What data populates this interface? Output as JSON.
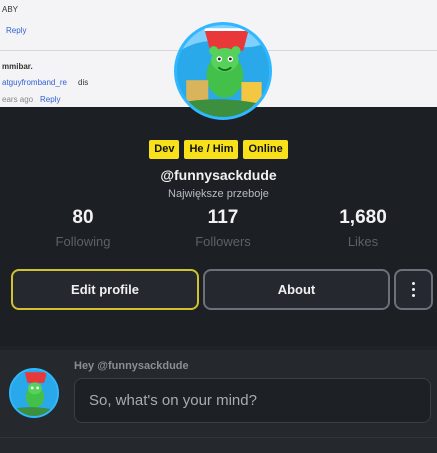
{
  "background_page": {
    "line1_text": "ABY",
    "line1_reply": "Reply",
    "line2_name": "mmibar.",
    "line2_link": "atguyfromband_re",
    "line2_suffix": "dis",
    "line2_time": "ears ago",
    "line2_reply": "Reply"
  },
  "profile": {
    "badges": [
      "Dev",
      "He / Him",
      "Online"
    ],
    "username": "@funnysackdude",
    "subtitle": "Największe przeboje",
    "stats": {
      "following": {
        "value": "80",
        "label": "Following"
      },
      "followers": {
        "value": "117",
        "label": "Followers"
      },
      "likes": {
        "value": "1,680",
        "label": "Likes"
      }
    },
    "buttons": {
      "edit": "Edit profile",
      "about": "About"
    }
  },
  "composer": {
    "greeting": "Hey @funnysackdude",
    "placeholder": "So, what's on your mind?"
  },
  "colors": {
    "accent_badge": "#f8e11a",
    "panel": "#1c1f24",
    "edit_border": "#cfc32e",
    "link": "#2f5fd6"
  },
  "icons": {
    "more": "vertical-dots-icon",
    "avatar": "gummy-bear-avatar"
  }
}
